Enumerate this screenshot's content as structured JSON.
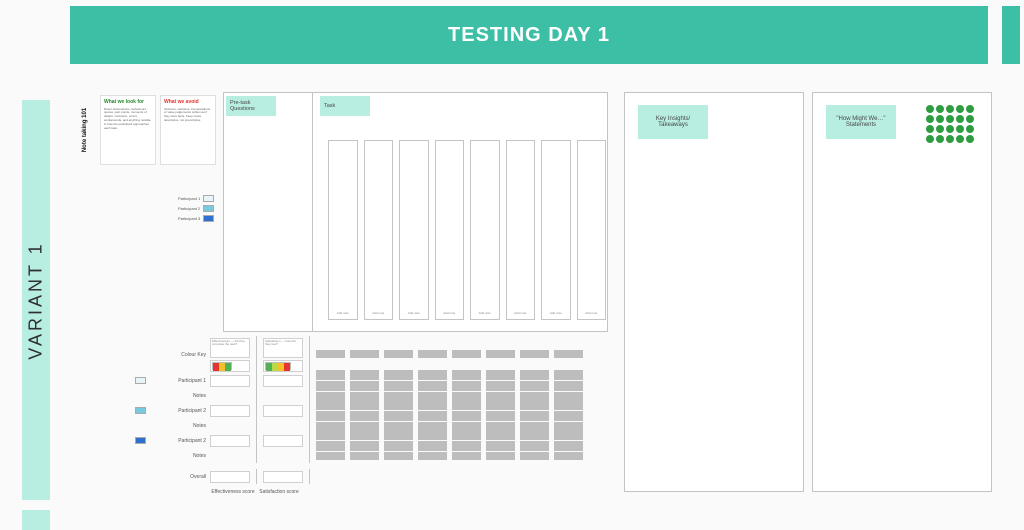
{
  "header": {
    "title": "TESTING DAY 1"
  },
  "sidebar": {
    "label": "VARIANT 1"
  },
  "notes_strip": "Note taking 101",
  "guides": {
    "look_for": {
      "title": "What we look for",
      "body": "Direct observations, behaviours, quotes, pain points, moments of delight, confusion, errors, workarounds, and anything notable in how the participant approaches each task."
    },
    "avoid": {
      "title": "What we avoid",
      "body": "Opinions, solutions, interpretations, or value judgements written as if they were facts. Keep notes descriptive, not prescriptive."
    }
  },
  "participant_legend": [
    "Participant 1",
    "Participant 2",
    "Participant 3"
  ],
  "task_area": {
    "pretask_label": "Pre-task Questions",
    "task_label": "Task",
    "column_caption": "Add note"
  },
  "matrix": {
    "colour_key_label": "Colour Key",
    "header_note_1": "Effectiveness — did they complete the task?",
    "header_note_2": "Satisfaction — how did they feel?",
    "rows": [
      {
        "chip": "c1",
        "label": "Participant 1"
      },
      {
        "chip": "",
        "label": "Notes"
      },
      {
        "chip": "c2",
        "label": "Participant 2"
      },
      {
        "chip": "",
        "label": "Notes"
      },
      {
        "chip": "c3",
        "label": "Participant 2"
      },
      {
        "chip": "",
        "label": "Notes"
      }
    ],
    "overall_label": "Overall",
    "footer_left": "Effectiveness score",
    "footer_right": "Satisfaction score",
    "key_colours_3": [
      "#e4352f",
      "#f3c22b",
      "#54b153"
    ],
    "key_colours_4": [
      "#54b153",
      "#b7d94a",
      "#f3c22b",
      "#e4352f"
    ]
  },
  "right_panels": {
    "insights": "Key Insights/\nTakeaways",
    "hmw": "\"How Might We…\"\nStatements"
  },
  "dot_grid": {
    "count": 20
  }
}
